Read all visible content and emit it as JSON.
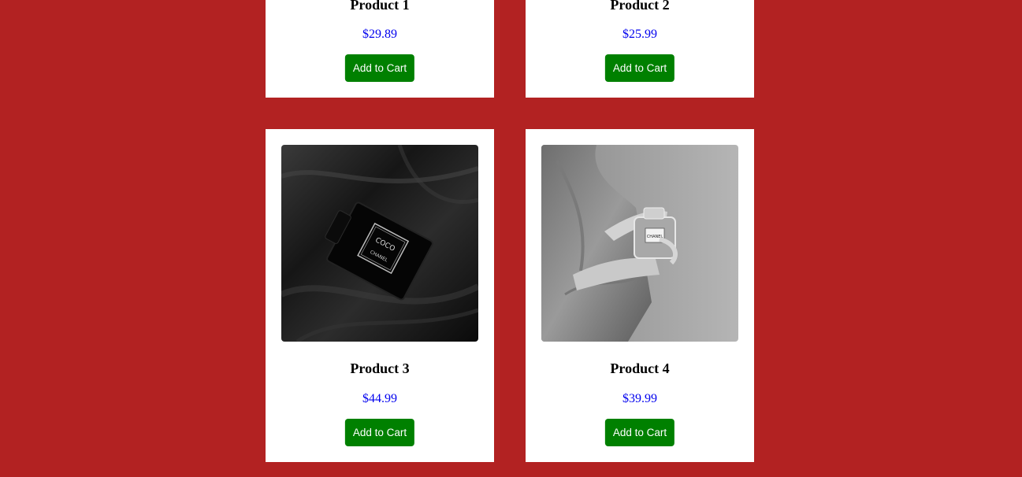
{
  "products": [
    {
      "name": "Product 1",
      "price": "$29.89",
      "button_label": "Add to Cart"
    },
    {
      "name": "Product 2",
      "price": "$25.99",
      "button_label": "Add to Cart"
    },
    {
      "name": "Product 3",
      "price": "$44.99",
      "button_label": "Add to Cart",
      "image": "perfume-bottle-on-black-satin"
    },
    {
      "name": "Product 4",
      "price": "$39.99",
      "button_label": "Add to Cart",
      "image": "hands-holding-perfume-bottle"
    }
  ],
  "colors": {
    "page_background": "#b22222",
    "card_background": "#ffffff",
    "price_text": "#0000ee",
    "button_background": "#008000",
    "button_text": "#ffffff"
  }
}
